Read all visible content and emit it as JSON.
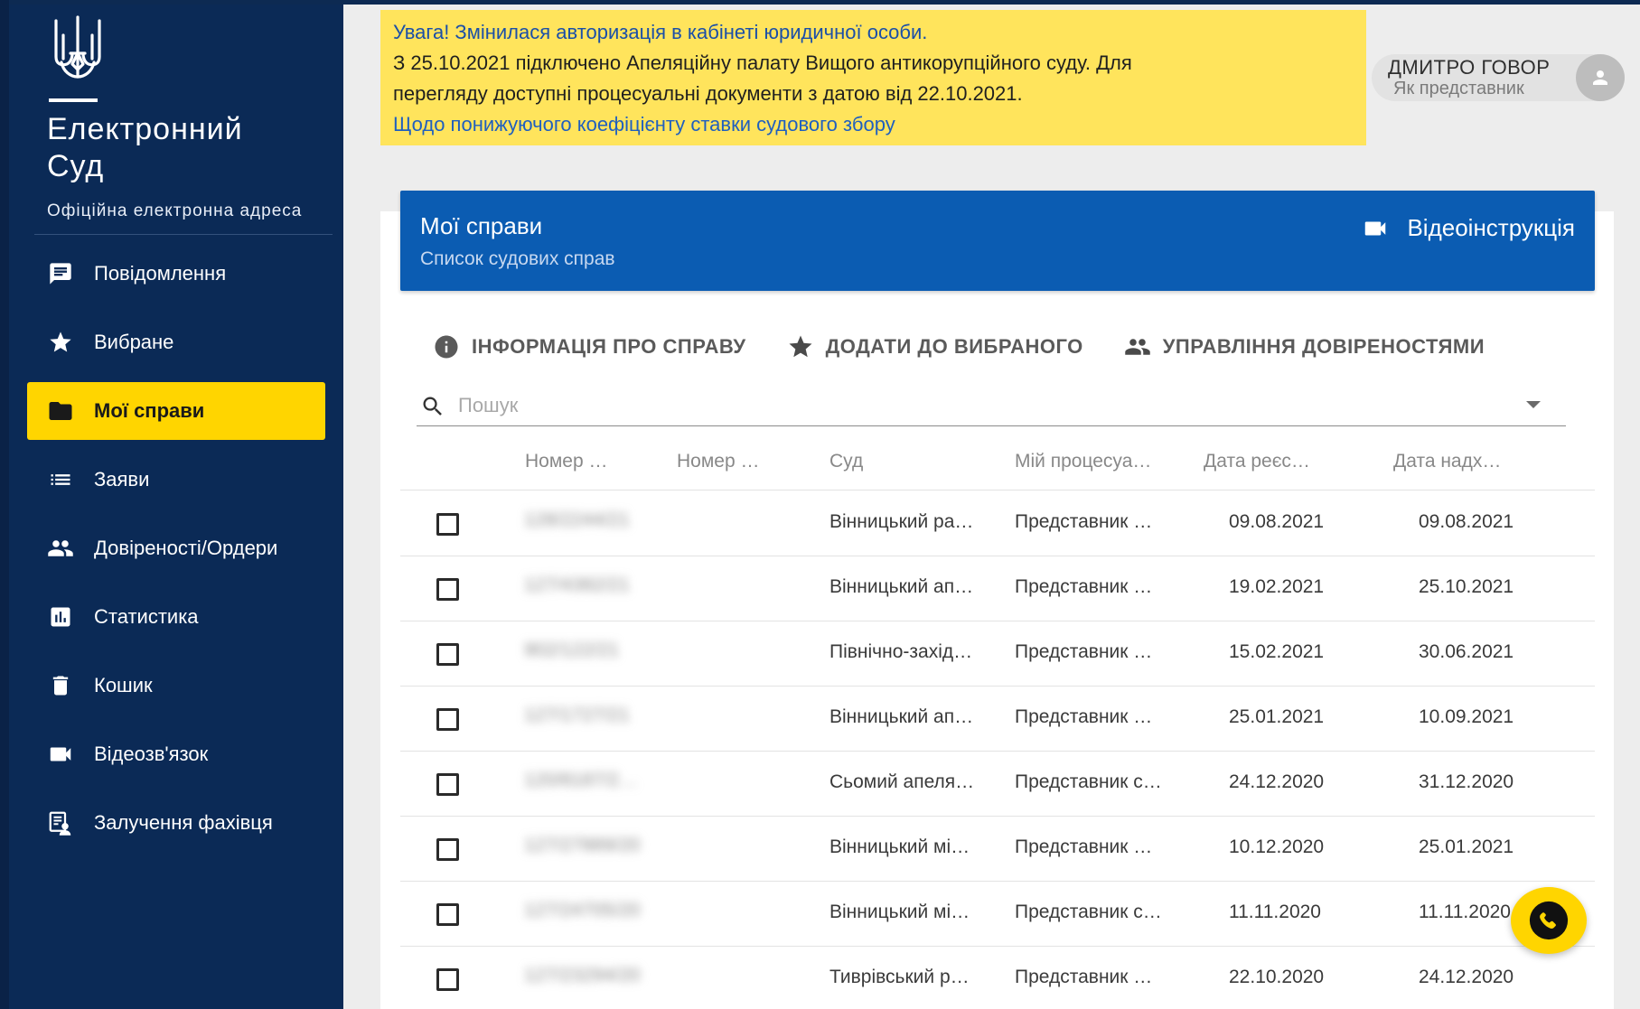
{
  "brand": {
    "title_line1": "Електронний",
    "title_line2": "Суд",
    "subtitle": "Офіційна електронна адреса"
  },
  "sidebar": {
    "items": [
      {
        "label": "Повідомлення",
        "icon": "message-icon"
      },
      {
        "label": "Вибране",
        "icon": "star-icon"
      },
      {
        "label": "Мої справи",
        "icon": "folder-icon",
        "active": true
      },
      {
        "label": "Заяви",
        "icon": "list-icon"
      },
      {
        "label": "Довіреності/Ордери",
        "icon": "people-icon"
      },
      {
        "label": "Статистика",
        "icon": "chart-icon"
      },
      {
        "label": "Кошик",
        "icon": "trash-icon"
      },
      {
        "label": "Відеозв'язок",
        "icon": "video-icon"
      },
      {
        "label": "Залучення фахівця",
        "icon": "expert-icon"
      }
    ]
  },
  "alert": {
    "line1": "Увага! Змінилася авторизація в кабінеті юридичної особи.",
    "line2": "З 25.10.2021 підключено Апеляційну палату Вищого антикорупційного суду. Для",
    "line3": "перегляду доступні процесуальні документи з датою від 22.10.2021.",
    "link": "Щодо понижуючого коефіцієнту ставки судового збору"
  },
  "user": {
    "name": "ДМИТРО ГОВОР",
    "role": "Як представник"
  },
  "card": {
    "title": "Мої справи",
    "subtitle": "Список судових справ",
    "video_label": "Відеоінструкція"
  },
  "actions": {
    "info": "ІНФОРМАЦІЯ ПРО СПРАВУ",
    "favorite": "ДОДАТИ ДО ВИБРАНОГО",
    "proxies": "УПРАВЛІННЯ ДОВІРЕНОСТЯМИ"
  },
  "search": {
    "placeholder": "Пошук"
  },
  "table": {
    "headers": [
      "Номер …",
      "Номер …",
      "Суд",
      "Мій процесуа…",
      "Дата реєс…",
      "Дата надх…"
    ],
    "rows": [
      {
        "num1": "128/2244/21",
        "num2": "",
        "court": "Вінницький ра…",
        "role": "Представник …",
        "reg": "09.08.2021",
        "recv": "09.08.2021"
      },
      {
        "num1": "127/4382/21",
        "num2": "",
        "court": "Вінницький ап…",
        "role": "Представник …",
        "reg": "19.02.2021",
        "recv": "25.10.2021"
      },
      {
        "num1": "902/122/21",
        "num2": "",
        "court": "Північно-захід…",
        "role": "Представник …",
        "reg": "15.02.2021",
        "recv": "30.06.2021"
      },
      {
        "num1": "127/1727/21",
        "num2": "",
        "court": "Вінницький ап…",
        "role": "Представник …",
        "reg": "25.01.2021",
        "recv": "10.09.2021"
      },
      {
        "num1": "120/8187/2…",
        "num2": "",
        "court": "Сьомий апеля…",
        "role": "Представник с…",
        "reg": "24.12.2020",
        "recv": "31.12.2020"
      },
      {
        "num1": "127/27889/20",
        "num2": "",
        "court": "Вінницький мі…",
        "role": "Представник …",
        "reg": "10.12.2020",
        "recv": "25.01.2021"
      },
      {
        "num1": "127/24705/20",
        "num2": "",
        "court": "Вінницький мі…",
        "role": "Представник с…",
        "reg": "11.11.2020",
        "recv": "11.11.2020"
      },
      {
        "num1": "127/23294/20",
        "num2": "",
        "court": "Тиврівський р…",
        "role": "Представник …",
        "reg": "22.10.2020",
        "recv": "24.12.2020"
      }
    ]
  },
  "colors": {
    "sidebar_bg": "#0b2a56",
    "accent_yellow": "#ffd500",
    "header_blue": "#0b5cb2",
    "alert_bg": "#ffe45c"
  }
}
